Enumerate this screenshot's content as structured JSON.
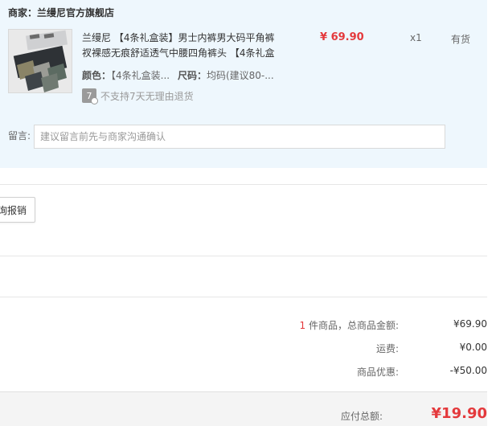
{
  "merchant": {
    "prefix": "商家：",
    "name": "兰缦尼官方旗舰店"
  },
  "product": {
    "title": "兰缦尼 【4条礼盒装】男士内裤男大码平角裤衩裸感无痕舒适透气中腰四角裤头 【4条礼盒",
    "color_label": "颜色：",
    "color_value": "【4条礼盒装...",
    "size_label": "尺码：",
    "size_value": "均码(建议80-...",
    "return_icon": "7",
    "return_text": "不支持7天无理由退货",
    "price": "¥ 69.90",
    "quantity": "x1",
    "stock": "有货"
  },
  "note": {
    "label": "留言:",
    "placeholder": "建议留言前先与商家沟通确认",
    "value": ""
  },
  "invoice": {
    "button_label": "询报销"
  },
  "summary": {
    "item_count": "1",
    "items_label": " 件商品，总商品金额:",
    "items_total": "¥69.90",
    "shipping_label": "运费:",
    "shipping_value": "¥0.00",
    "discount_label": "商品优惠:",
    "discount_value": "-¥50.00"
  },
  "payment": {
    "label": "应付总额:",
    "total": "¥19.90"
  },
  "colors": {
    "accent": "#e4393c",
    "panel": "#eef7fd"
  }
}
